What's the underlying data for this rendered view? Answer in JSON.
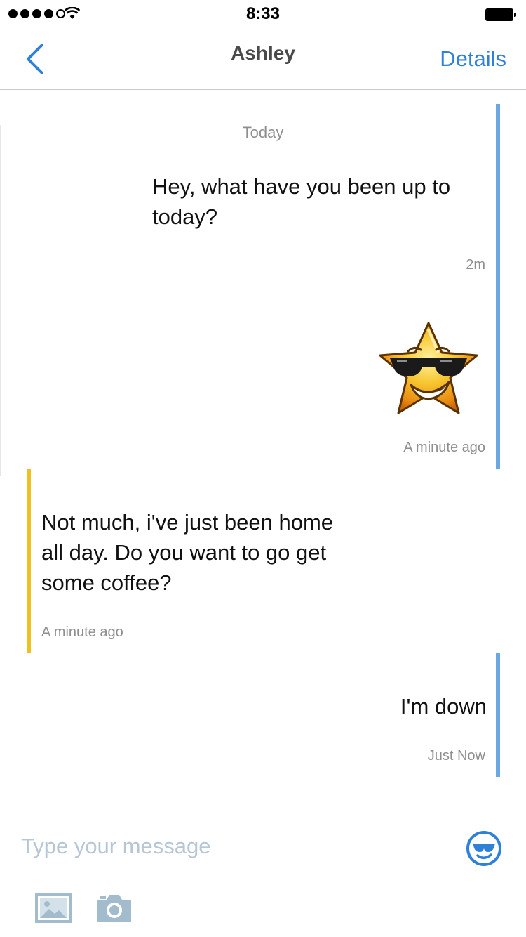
{
  "status_bar": {
    "time": "8:33",
    "signal_bars": 4,
    "signal_total": 5,
    "wifi_icon": "wifi-icon",
    "battery_icon": "battery-full-icon"
  },
  "nav": {
    "back_icon": "chevron-left-icon",
    "title": "Ashley",
    "details_label": "Details"
  },
  "conversation": {
    "day_label": "Today",
    "messages": [
      {
        "side": "right",
        "lines": [
          "Hey, what have you been up to",
          "today?"
        ],
        "time": "2m"
      },
      {
        "side": "right",
        "sticker": "sunglasses-star-sticker",
        "time": "A minute ago"
      },
      {
        "side": "left",
        "lines": [
          "Not much, i've just been home",
          "all day. Do you want to go get",
          "some coffee?"
        ],
        "time": "A minute ago"
      },
      {
        "side": "right",
        "lines": [
          "I'm down"
        ],
        "time": "Just Now"
      }
    ]
  },
  "composer": {
    "placeholder": "Type your message",
    "emoji_icon": "sunglasses-smiley-icon",
    "gallery_icon": "image-icon",
    "camera_icon": "camera-icon"
  },
  "colors": {
    "accent_blue": "#2f80d8",
    "outgoing_bar": "#6aa7e3",
    "incoming_bar": "#f0c020",
    "timestamp": "#8e8e8e",
    "placeholder": "#b6c6d2",
    "toolbar_icons": "#a3bccd"
  }
}
